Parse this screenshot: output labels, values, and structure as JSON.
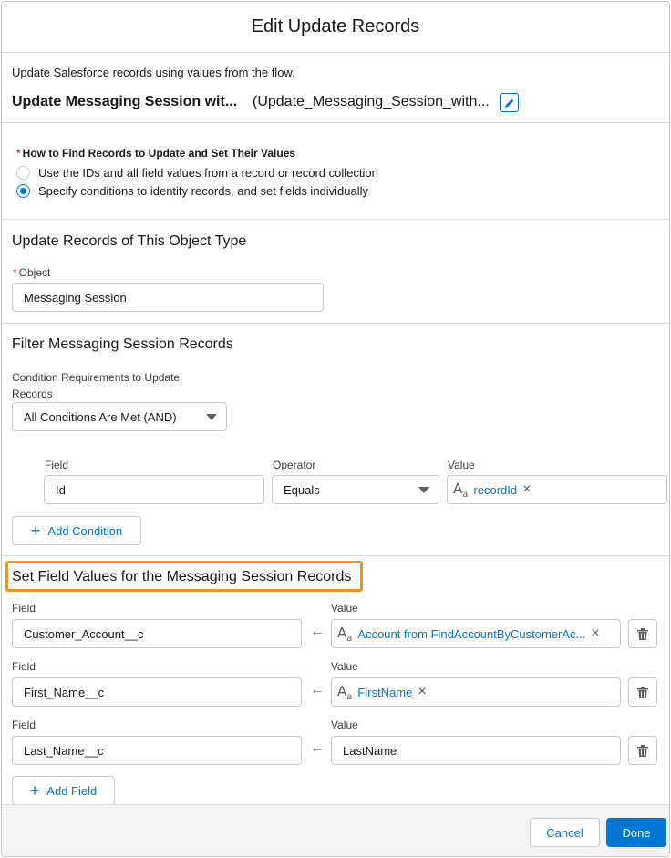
{
  "modal": {
    "title": "Edit Update Records",
    "description": "Update Salesforce records using values from the flow.",
    "element_label": "Update Messaging Session wit...",
    "element_api_name": "(Update_Messaging_Session_with..."
  },
  "find_records": {
    "label": "How to Find Records to Update and Set Their Values",
    "options": [
      {
        "label": "Use the IDs and all field values from a record or record collection",
        "selected": false
      },
      {
        "label": "Specify conditions to identify records, and set fields individually",
        "selected": true
      }
    ]
  },
  "object_section": {
    "title": "Update Records of This Object Type",
    "object_label": "Object",
    "object_value": "Messaging Session"
  },
  "filter_section": {
    "title": "Filter Messaging Session Records",
    "condition_label_line1": "Condition Requirements to Update",
    "condition_label_line2": "Records",
    "condition_value": "All Conditions Are Met (AND)",
    "headers": {
      "field": "Field",
      "operator": "Operator",
      "value": "Value"
    },
    "condition": {
      "field": "Id",
      "operator": "Equals",
      "value": "recordId"
    },
    "add_condition_label": "Add Condition"
  },
  "set_fields_section": {
    "title": "Set Field Values for the Messaging Session Records",
    "field_header": "Field",
    "value_header": "Value",
    "rows": [
      {
        "field": "Customer_Account__c",
        "value": "Account from FindAccountByCustomerAc...",
        "is_resource": true
      },
      {
        "field": "First_Name__c",
        "value": "FirstName",
        "is_resource": true
      },
      {
        "field": "Last_Name__c",
        "value": "LastName",
        "is_resource": false
      }
    ],
    "add_field_label": "Add Field"
  },
  "footer": {
    "cancel_label": "Cancel",
    "done_label": "Done"
  },
  "icons": {
    "edit": "pencil-icon",
    "resource": "text-resource-icon",
    "remove": "close-icon",
    "delete": "trash-icon",
    "assign": "left-arrow-icon",
    "dropdown": "chevron-down-icon",
    "add": "plus-icon"
  },
  "colors": {
    "accent": "#0176d3",
    "highlight": "#f0961e",
    "required": "#c23934"
  }
}
